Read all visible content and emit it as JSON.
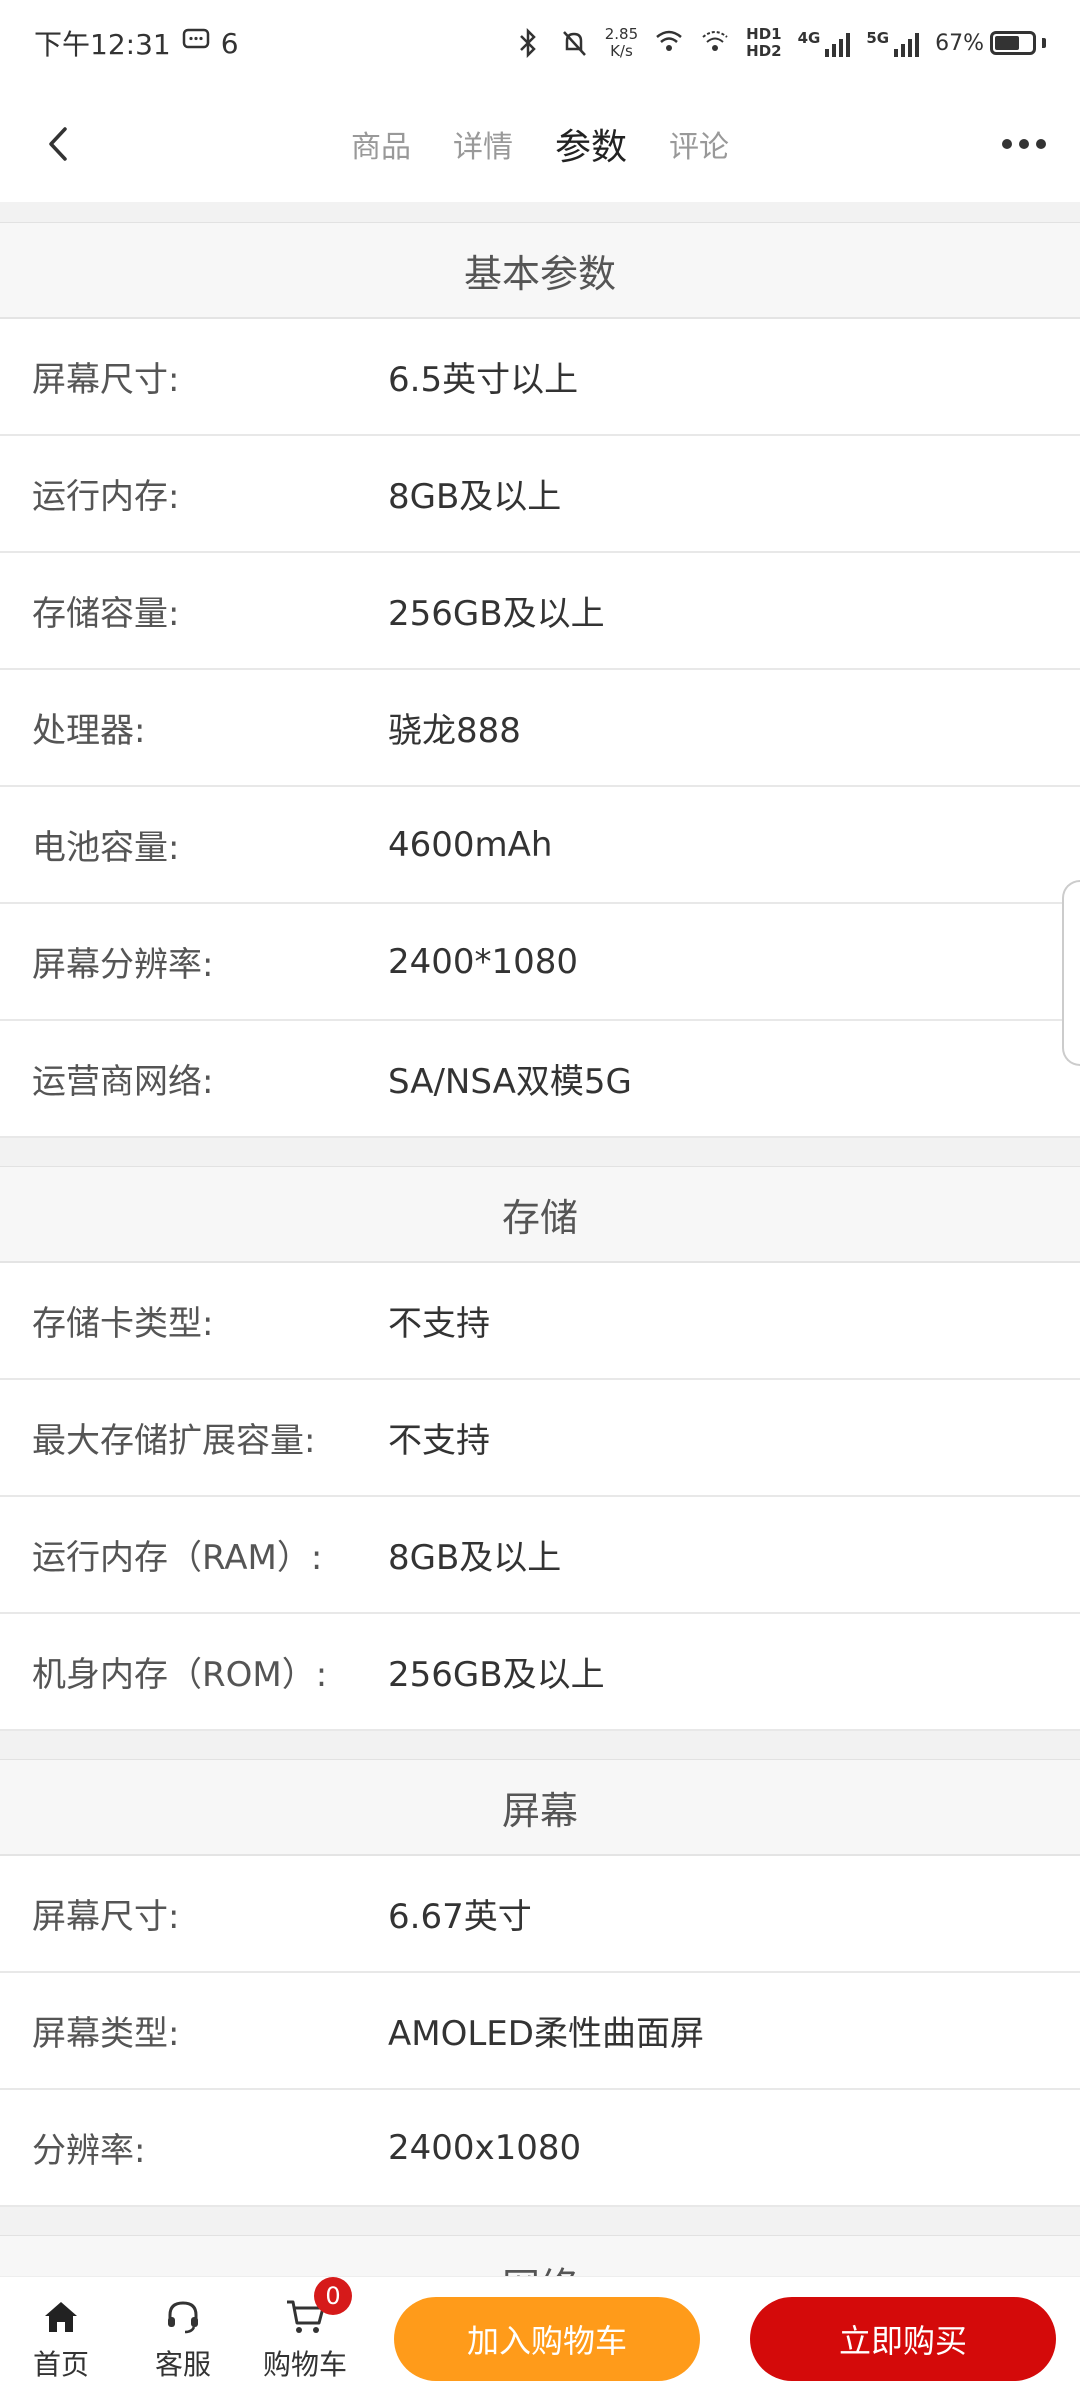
{
  "status_bar": {
    "time": "下午12:31",
    "notif_count": "6",
    "net_speed_value": "2.85",
    "net_speed_unit": "K/s",
    "hd1": "HD1",
    "hd2": "HD2",
    "net_4g": "4G",
    "net_5g": "5G",
    "battery": "67%",
    "battery_level": 0.67
  },
  "nav": {
    "tabs": [
      {
        "label": "商品"
      },
      {
        "label": "详情"
      },
      {
        "label": "参数"
      },
      {
        "label": "评论"
      }
    ],
    "active_tab": "参数"
  },
  "sections": [
    {
      "title": "基本参数",
      "rows": [
        {
          "label": "屏幕尺寸:",
          "value": "6.5英寸以上"
        },
        {
          "label": "运行内存:",
          "value": "8GB及以上"
        },
        {
          "label": "存储容量:",
          "value": "256GB及以上"
        },
        {
          "label": "处理器:",
          "value": "骁龙888"
        },
        {
          "label": "电池容量:",
          "value": "4600mAh"
        },
        {
          "label": "屏幕分辨率:",
          "value": "2400*1080"
        },
        {
          "label": "运营商网络:",
          "value": "SA/NSA双模5G"
        }
      ]
    },
    {
      "title": "存储",
      "rows": [
        {
          "label": "存储卡类型:",
          "value": "不支持"
        },
        {
          "label": "最大存储扩展容量:",
          "value": "不支持"
        },
        {
          "label": "运行内存（RAM）:",
          "value": "8GB及以上"
        },
        {
          "label": "机身内存（ROM）:",
          "value": "256GB及以上"
        }
      ]
    },
    {
      "title": "屏幕",
      "rows": [
        {
          "label": "屏幕尺寸:",
          "value": "6.67英寸"
        },
        {
          "label": "屏幕类型:",
          "value": "AMOLED柔性曲面屏"
        },
        {
          "label": "分辨率:",
          "value": "2400x1080"
        }
      ]
    },
    {
      "title": "网络",
      "rows": []
    }
  ],
  "bottom_bar": {
    "home_label": "首页",
    "service_label": "客服",
    "cart_label": "购物车",
    "cart_count": "0",
    "add_to_cart_label": "加入购物车",
    "buy_now_label": "立即购买"
  },
  "colors": {
    "add_to_cart": "#ff9b1a",
    "buy_now": "#d40a0a",
    "badge": "#d61a1a"
  }
}
